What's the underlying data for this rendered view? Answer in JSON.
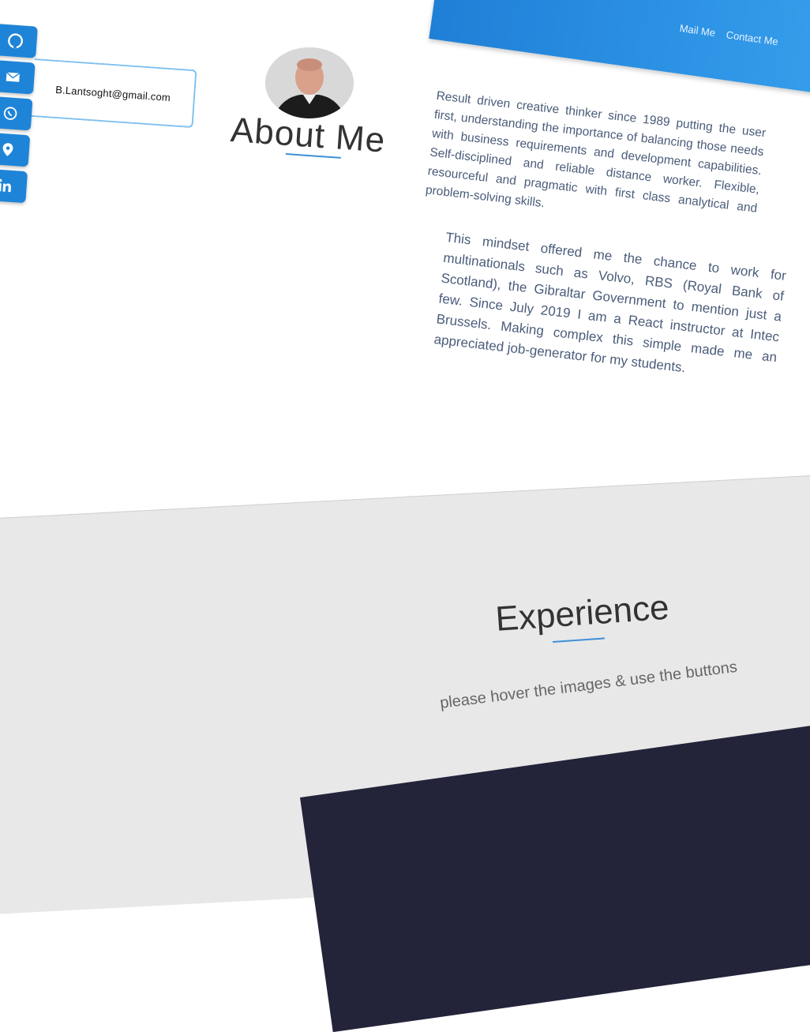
{
  "nav": {
    "items": [
      "Mail Me",
      "Contact Me"
    ]
  },
  "social": {
    "icons": [
      "github-icon",
      "mail-icon",
      "whatsapp-icon",
      "location-icon",
      "linkedin-icon"
    ],
    "email": "B.Lantsoght@gmail.com"
  },
  "about": {
    "title": "About Me",
    "paragraph1": "Result driven creative thinker since 1989 putting the user first, understanding the importance of balancing those needs with business requirements and development capabilities. Self-disciplined and reliable distance worker. Flexible, resourceful and pragmatic with first class analytical and problem-solving skills.",
    "paragraph2": "This mindset offered me the chance to work for multinationals such as Volvo, RBS (Royal Bank of Scotland), the Gibraltar Government to mention just a few. Since July 2019 I am a React instructor at Intec Brussels. Making complex this simple made me an appreciated job-generator for my students."
  },
  "experience": {
    "title": "Experience",
    "subtitle": "please hover the images & use the buttons"
  },
  "colors": {
    "accent": "#1e84d8",
    "text": "#4a5c7a",
    "section_bg": "#e8e8e8",
    "footer_bg": "#23233a"
  }
}
